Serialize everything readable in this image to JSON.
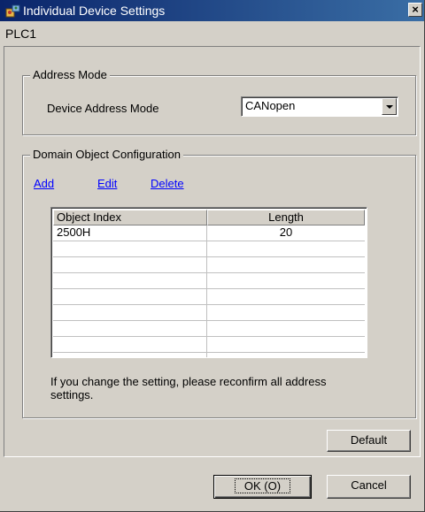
{
  "window": {
    "title": "Individual Device Settings",
    "close_glyph": "×"
  },
  "device": {
    "name": "PLC1"
  },
  "address_mode": {
    "group_label": "Address Mode",
    "field_label": "Device Address Mode",
    "selected_value": "CANopen"
  },
  "domain_config": {
    "group_label": "Domain Object Configuration",
    "links": {
      "add": "Add",
      "edit": "Edit",
      "delete": "Delete"
    },
    "columns": [
      "Object Index",
      "Length"
    ],
    "rows": [
      {
        "object_index": "2500H",
        "length": "20"
      }
    ],
    "note": "If you change the setting, please reconfirm all address settings."
  },
  "buttons": {
    "default": "Default",
    "ok": "OK (O)",
    "cancel": "Cancel"
  },
  "icons": {
    "app": "device-settings-icon",
    "close": "close-icon",
    "dropdown": "chevron-down-icon"
  }
}
